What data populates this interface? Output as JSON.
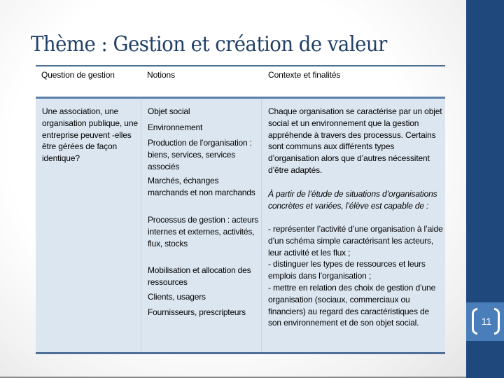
{
  "slide": {
    "title": "Thème : Gestion et création de valeur",
    "slide_number": "11",
    "colors": {
      "title": "#1f3f66",
      "sidebar": "#1f497d",
      "slide_number_band": "#4a7ebb",
      "table_body": "#dce6f0",
      "table_rule": "#4f6f98"
    }
  },
  "table": {
    "headers": [
      "Question de gestion",
      "Notions",
      "Contexte et finalités"
    ],
    "question": "Une association, une organisation publique, une entreprise peuvent -elles être gérées de façon identique?",
    "notions": [
      "Objet social",
      "Environnement",
      "Production de l’organisation : biens, services, services associés",
      "Marchés, échanges marchands et non marchands",
      "Processus de gestion : acteurs internes et externes, activités, flux, stocks",
      "Mobilisation et allocation des ressources",
      "Clients, usagers",
      "Fournisseurs, prescripteurs"
    ],
    "context": {
      "intro": "Chaque organisation se caractérise par un objet social et un environnement que la gestion appréhende à travers des processus. Certains sont communs aux différents types d’organisation alors que d’autres nécessitent d’être adaptés.",
      "italic_lead": "À partir de l’étude de situations d’organisations concrètes et variées, l’élève est capable de :",
      "bullets": [
        "- représenter l’activité d’une organisation à l’aide d’un schéma simple caractérisant les acteurs, leur activité et les flux ;",
        "- distinguer les types de ressources et leurs emplois dans l’organisation ;",
        "- mettre en relation des choix de gestion d’une organisation (sociaux, commerciaux ou financiers) au regard des caractéristiques de son environnement et de son objet social."
      ]
    }
  }
}
